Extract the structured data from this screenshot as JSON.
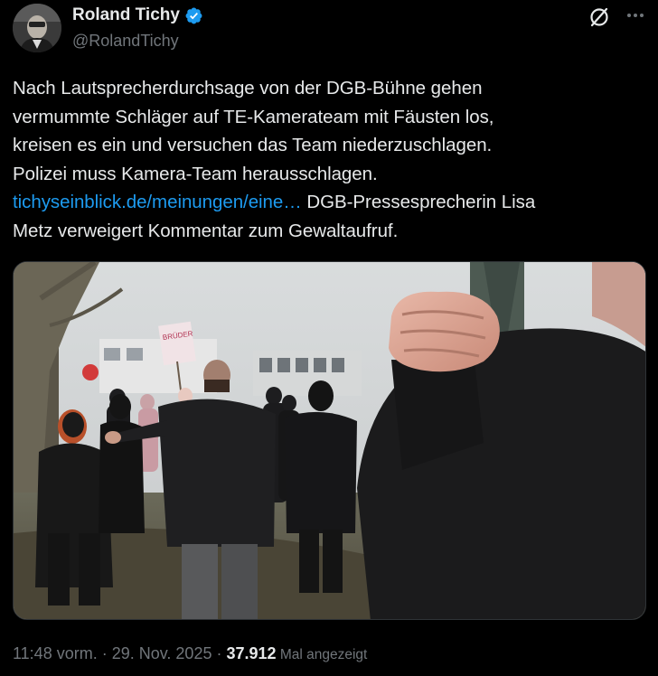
{
  "author": {
    "name": "Roland Tichy",
    "handle": "@RolandTichy",
    "verified": true,
    "avatar_icon": "avatar-photo"
  },
  "actions": {
    "grok_icon": "grok-icon",
    "more_icon": "more-horizontal-icon"
  },
  "tweet": {
    "lines": [
      "Nach Lautsprecherdurchsage von der DGB-Bühne gehen",
      "vermummte Schläger auf TE-Kamerateam mit Fäusten los,",
      "kreisen es ein und versuchen das Team niederzuschlagen.",
      "Polizei muss Kamera-Team herausschlagen."
    ],
    "link_text": "tichyseinblick.de/meinungen/eine…",
    "after_link": " DGB-Pressesprecherin Lisa",
    "last_line": "Metz verweigert Kommentar zum  Gewaltaufruf."
  },
  "media": {
    "sign_text": "BRÜDER"
  },
  "footer": {
    "time": "11:48 vorm.",
    "separator": " · ",
    "date": "29. Nov. 2025",
    "separator2": " · ",
    "views_count": "37.912",
    "views_label": " Mal angezeigt"
  },
  "colors": {
    "background": "#000000",
    "text": "#e7e9ea",
    "secondary": "#71767b",
    "link": "#1d9bf0",
    "verified": "#1d9bf0"
  }
}
